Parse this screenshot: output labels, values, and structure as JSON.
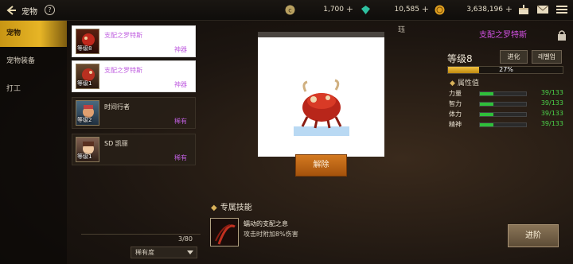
{
  "header": {
    "title": "宠物",
    "help_label": "?",
    "currencies": [
      {
        "icon": "coin-icon",
        "value": "1,700",
        "plus": "+"
      },
      {
        "icon": "gem-icon",
        "value": "10,585",
        "plus": "+"
      },
      {
        "icon": "gold-icon",
        "value": "3,638,196",
        "plus": "+"
      }
    ]
  },
  "sidebar": {
    "tabs": [
      {
        "label": "宠物",
        "active": true
      },
      {
        "label": "宠物装备",
        "active": false
      },
      {
        "label": "打工",
        "active": false
      }
    ]
  },
  "pet_list": {
    "items": [
      {
        "name": "支配之罗特斯",
        "level": "等级8",
        "grade": "神器",
        "selected": true
      },
      {
        "name": "支配之罗特斯",
        "level": "等级1",
        "grade": "神器",
        "selected": true
      },
      {
        "name": "时间行者",
        "level": "等级2",
        "grade": "稀有",
        "selected": false
      },
      {
        "name": "SD 凯丽",
        "level": "等级1",
        "grade": "稀有",
        "selected": false
      }
    ],
    "count": "3/80",
    "sort_label": "稀有度"
  },
  "preview": {
    "release_label": "解除",
    "cut_glyph": "珏"
  },
  "skill": {
    "section_title": "专属技能",
    "name": "蠕动的支配之息",
    "description": "攻击时附加8%伤害"
  },
  "detail": {
    "name": "支配之罗特斯",
    "level_label": "等级8",
    "evolve_label": "进化",
    "reset_label": "레벨업",
    "exp_percent": 27,
    "exp_text": "27%",
    "attr_title": "属性值",
    "attributes": [
      {
        "label": "力量",
        "value": "39/133",
        "fraction": 0.29
      },
      {
        "label": "智力",
        "value": "39/133",
        "fraction": 0.29
      },
      {
        "label": "体力",
        "value": "39/133",
        "fraction": 0.29
      },
      {
        "label": "精神",
        "value": "39/133",
        "fraction": 0.29
      }
    ],
    "advance_label": "进阶"
  },
  "colors": {
    "accent_gold": "#e7b526",
    "artifact_purple": "#d050e0",
    "stat_green": "#2fbf3a",
    "button_orange": "#c86a18"
  }
}
